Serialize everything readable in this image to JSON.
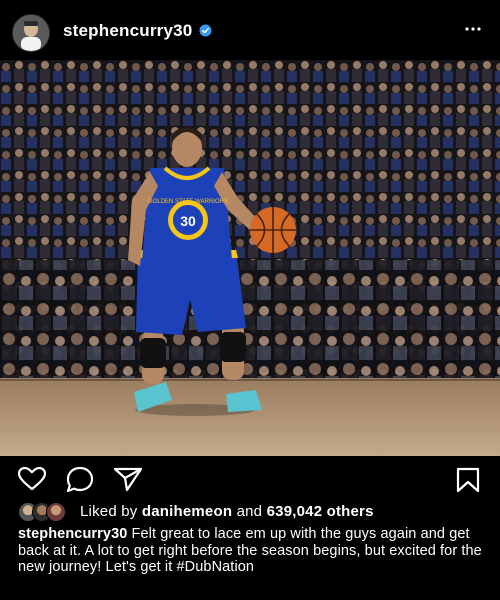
{
  "post": {
    "username": "stephencurry30",
    "verified": true,
    "accent_color": "#3897f0"
  },
  "icons": {
    "avatar": "profile-avatar",
    "verified": "verified-badge-icon",
    "more": "more-options-icon",
    "like": "heart-icon",
    "comment": "comment-icon",
    "share": "paper-plane-icon",
    "save": "bookmark-icon"
  },
  "likes": {
    "prefix": "Liked by",
    "user": "danihemeon",
    "middle": "and",
    "count": "639,042 others"
  },
  "caption": {
    "user": "stephencurry30",
    "text": "Felt great to lace em up with the guys again and get back at it. A lot to get right before the season begins, but excited for the new journey! Let's get it #DubNation"
  },
  "photo": {
    "jersey_text": "GOLDEN STATE WARRIORS",
    "jersey_number": "30"
  }
}
